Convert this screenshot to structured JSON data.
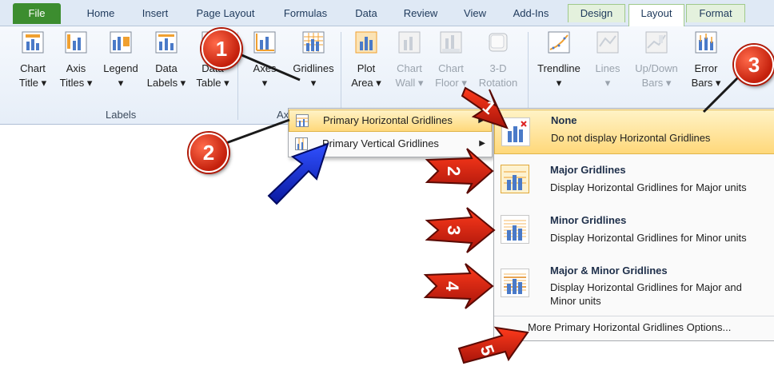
{
  "tabs": [
    "File",
    "Home",
    "Insert",
    "Page Layout",
    "Formulas",
    "Data",
    "Review",
    "View",
    "Add-Ins",
    "Design",
    "Layout",
    "Format"
  ],
  "ribbon": {
    "chart_title": [
      "Chart",
      "Title ▾"
    ],
    "axis_titles": [
      "Axis",
      "Titles ▾"
    ],
    "legend": [
      "Legend",
      "▾"
    ],
    "data_labels": [
      "Data",
      "Labels ▾"
    ],
    "data_table": [
      "Data",
      "Table ▾"
    ],
    "axes": [
      "Axes",
      "▾"
    ],
    "gridlines": [
      "Gridlines",
      "▾"
    ],
    "plot_area": [
      "Plot",
      "Area ▾"
    ],
    "chart_wall": [
      "Chart",
      "Wall ▾"
    ],
    "chart_floor": [
      "Chart",
      "Floor ▾"
    ],
    "rotation_3d": [
      "3-D",
      "Rotation"
    ],
    "trendline": [
      "Trendline",
      "▾"
    ],
    "lines": [
      "Lines",
      "▾"
    ],
    "updown_bars": [
      "Up/Down",
      "Bars ▾"
    ],
    "error_bars": [
      "Error",
      "Bars ▾"
    ],
    "group_labels": "Labels",
    "group_axes": "Axes"
  },
  "menu1": {
    "horizontal": "Primary Horizontal Gridlines",
    "vertical": "Primary Vertical Gridlines"
  },
  "menu2": {
    "none_title": "None",
    "none_desc": "Do not display Horizontal Gridlines",
    "major_title": "Major Gridlines",
    "major_desc": "Display Horizontal Gridlines for Major units",
    "minor_title": "Minor Gridlines",
    "minor_desc": "Display Horizontal Gridlines for Minor units",
    "both_title": "Major & Minor Gridlines",
    "both_desc_1": "Display Horizontal Gridlines for Major and",
    "both_desc_2": "Minor units",
    "more": "More Primary Horizontal Gridlines Options..."
  },
  "callouts": [
    "1",
    "2",
    "3"
  ],
  "arrow_numbers": [
    "1",
    "2",
    "3",
    "4",
    "5"
  ],
  "colors": {
    "accent_green": "#3c8d2f",
    "callout_red": "#d62a12",
    "highlight": "#ffd87a",
    "blue_arrow": "#1a2fd8"
  }
}
